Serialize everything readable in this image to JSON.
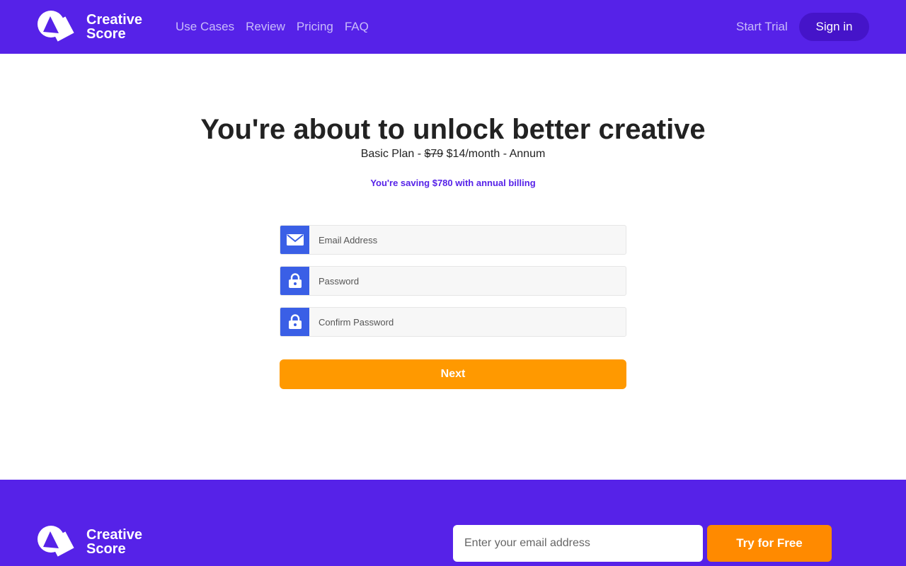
{
  "brand": {
    "line1": "Creative",
    "line2": "Score"
  },
  "nav": {
    "items": [
      {
        "label": "Use Cases"
      },
      {
        "label": "Review"
      },
      {
        "label": "Pricing"
      },
      {
        "label": "FAQ"
      }
    ],
    "start_trial": "Start Trial",
    "sign_in": "Sign in"
  },
  "main": {
    "title": "You're about to unlock better creative",
    "plan_prefix": "Basic Plan - ",
    "old_price": "$79",
    "new_price": " $14/month - Annum",
    "saving": "You're saving $780 with annual billing"
  },
  "form": {
    "email_placeholder": "Email Address",
    "password_placeholder": "Password",
    "confirm_placeholder": "Confirm Password",
    "next_label": "Next"
  },
  "footer": {
    "email_placeholder": "Enter your email address",
    "try_label": "Try for Free"
  },
  "colors": {
    "brand_purple": "#5622e8",
    "sign_in_bg": "#4514c9",
    "icon_blue": "#3a5fe6",
    "next_orange": "#ff9900",
    "try_orange": "#ff8a00"
  },
  "icons": {
    "logo": "creative-score-logo-icon",
    "email": "envelope-icon",
    "password": "lock-icon"
  }
}
